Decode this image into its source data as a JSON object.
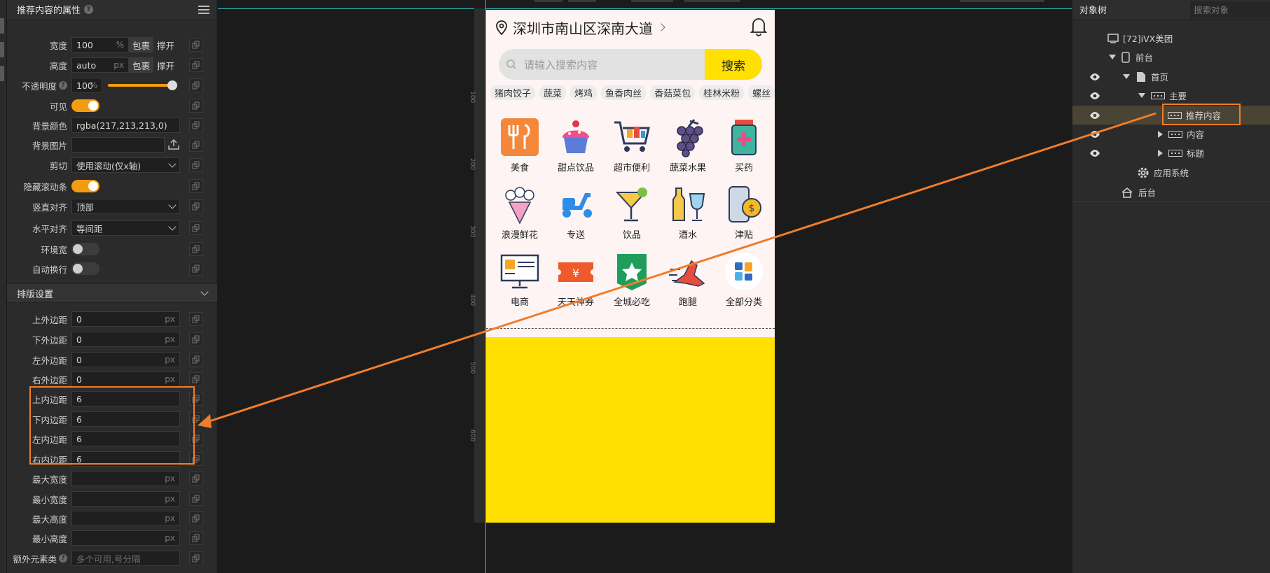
{
  "props": {
    "title": "推荐内容的属性",
    "help": "?",
    "width": {
      "label": "宽度",
      "value": "100",
      "unit": "%",
      "opt1": "包裹",
      "opt2": "撑开"
    },
    "height": {
      "label": "高度",
      "value": "auto",
      "unit": "px",
      "opt1": "包裹",
      "opt2": "撑开"
    },
    "opacity": {
      "label": "不透明度",
      "value": "100",
      "unit": "%",
      "level": 1.0
    },
    "visible": {
      "label": "可见"
    },
    "bg_color": {
      "label": "背景颜色",
      "value": "rgba(217,213,213,0)"
    },
    "bg_image": {
      "label": "背景图片"
    },
    "clip": {
      "label": "剪切",
      "value": "使用滚动(仅x轴)"
    },
    "hide_scrollbar": {
      "label": "隐藏滚动条"
    },
    "valign": {
      "label": "竖直对齐",
      "value": "顶部"
    },
    "halign": {
      "label": "水平对齐",
      "value": "等间距"
    },
    "wrap_width": {
      "label": "环境宽"
    },
    "auto_wrap": {
      "label": "自动换行"
    },
    "layout_section": "排版设置",
    "margin_top": {
      "label": "上外边距",
      "value": "0",
      "unit": "px"
    },
    "margin_bottom": {
      "label": "下外边距",
      "value": "0",
      "unit": "px"
    },
    "margin_left": {
      "label": "左外边距",
      "value": "0",
      "unit": "px"
    },
    "margin_right": {
      "label": "右外边距",
      "value": "0",
      "unit": "px"
    },
    "padding_top": {
      "label": "上内边距",
      "value": "6"
    },
    "padding_bottom": {
      "label": "下内边距",
      "value": "6"
    },
    "padding_left": {
      "label": "左内边距",
      "value": "6"
    },
    "padding_right": {
      "label": "右内边距",
      "value": "6"
    },
    "max_width": {
      "label": "最大宽度",
      "unit": "px"
    },
    "min_width": {
      "label": "最小宽度",
      "unit": "px"
    },
    "max_height": {
      "label": "最大高度",
      "unit": "px"
    },
    "min_height": {
      "label": "最小高度",
      "unit": "px"
    },
    "extra_class": {
      "label": "额外元素类",
      "placeholder": "多个可用,号分隔"
    }
  },
  "ruler": [
    "100",
    "200",
    "300",
    "400",
    "500",
    "600"
  ],
  "phone": {
    "location": "深圳市南山区深南大道",
    "search_placeholder": "请输入搜索内容",
    "search_button": "搜索",
    "tags": [
      "猪肉饺子",
      "蔬菜",
      "烤鸡",
      "鱼香肉丝",
      "香菇菜包",
      "桂林米粉",
      "螺丝"
    ],
    "categories": [
      {
        "label": "美食",
        "icon": "food-icon"
      },
      {
        "label": "甜点饮品",
        "icon": "cupcake-icon"
      },
      {
        "label": "超市便利",
        "icon": "cart-icon"
      },
      {
        "label": "蔬菜水果",
        "icon": "grapes-icon"
      },
      {
        "label": "买药",
        "icon": "medicine-icon"
      },
      {
        "label": "浪漫鲜花",
        "icon": "bouquet-icon"
      },
      {
        "label": "专送",
        "icon": "scooter-icon"
      },
      {
        "label": "饮品",
        "icon": "cocktail-icon"
      },
      {
        "label": "酒水",
        "icon": "wine-icon"
      },
      {
        "label": "津贴",
        "icon": "phone-coin-icon"
      },
      {
        "label": "电商",
        "icon": "sale-monitor-icon"
      },
      {
        "label": "天天神券",
        "icon": "coupon-icon"
      },
      {
        "label": "全城必吃",
        "icon": "star-badge-icon"
      },
      {
        "label": "跑腿",
        "icon": "running-shoe-icon"
      },
      {
        "label": "全部分类",
        "icon": "grid-apps-icon"
      }
    ]
  },
  "tree": {
    "title": "对象树",
    "search_placeholder": "搜索对象",
    "nodes": [
      {
        "label": "[72]iVX美团"
      },
      {
        "label": "前台"
      },
      {
        "label": "首页"
      },
      {
        "label": "主要"
      },
      {
        "label": "推荐内容"
      },
      {
        "label": "内容"
      },
      {
        "label": "标题"
      },
      {
        "label": "应用系统"
      },
      {
        "label": "后台"
      }
    ]
  },
  "colors": {
    "accent": "#f39c12",
    "highlight": "#f07d2a",
    "brand_yellow": "#ffe000",
    "guide": "#30b9b9"
  }
}
